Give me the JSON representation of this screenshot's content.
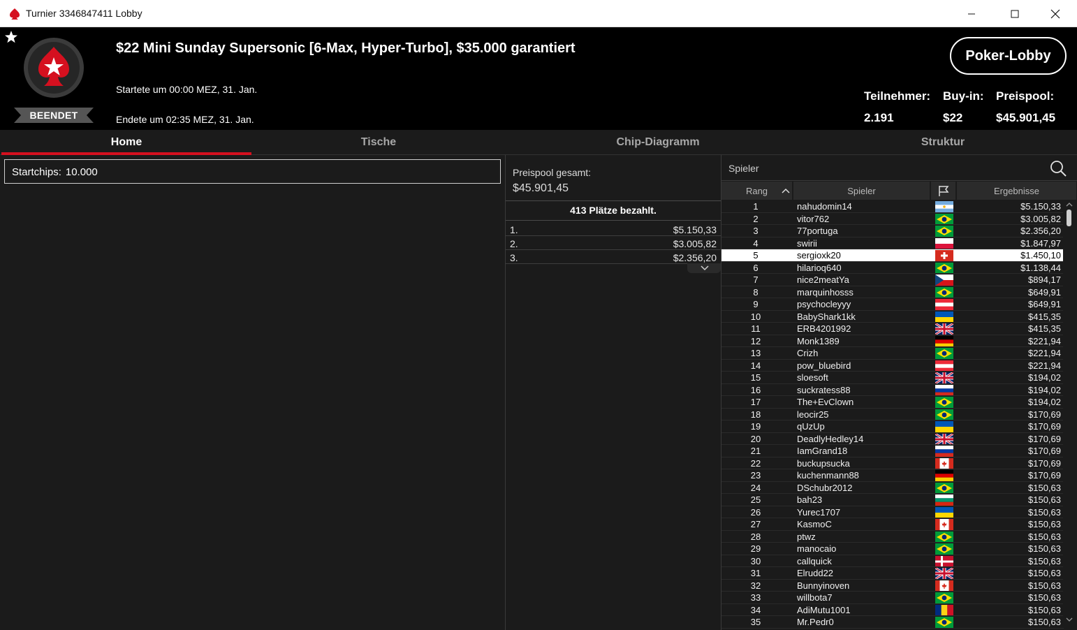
{
  "window": {
    "title": "Turnier 3346847411 Lobby"
  },
  "header": {
    "tournament_name": "$22 Mini Sunday Supersonic [6-Max, Hyper-Turbo], $35.000 garantiert",
    "start_text": "Startete um 00:00 MEZ, 31. Jan.",
    "end_text": "Endete um 02:35 MEZ, 31. Jan.",
    "status": "BEENDET",
    "lobby_button": "Poker-Lobby",
    "stats": {
      "participants_label": "Teilnehmer:",
      "participants": "2.191",
      "buyin_label": "Buy-in:",
      "buyin": "$22",
      "prizepool_label": "Preispool:",
      "prizepool": "$45.901,45"
    }
  },
  "tabs": [
    "Home",
    "Tische",
    "Chip-Diagramm",
    "Struktur"
  ],
  "home": {
    "startchips_label": "Startchips:",
    "startchips": "10.000"
  },
  "prizes": {
    "pool_label": "Preispool gesamt:",
    "pool_value": "$45.901,45",
    "paid_text": "413 Plätze bezahlt.",
    "rows": [
      {
        "place": "1.",
        "amount": "$5.150,33"
      },
      {
        "place": "2.",
        "amount": "$3.005,82"
      },
      {
        "place": "3.",
        "amount": "$2.356,20"
      }
    ]
  },
  "players": {
    "search_placeholder": "Spieler",
    "headers": {
      "rank": "Rang",
      "player": "Spieler",
      "result": "Ergebnisse"
    },
    "selected_rank": 5,
    "rows": [
      {
        "rank": "1",
        "name": "nahudomin14",
        "flag": "argentina",
        "result": "$5.150,33"
      },
      {
        "rank": "2",
        "name": "vitor762",
        "flag": "brazil",
        "result": "$3.005,82"
      },
      {
        "rank": "3",
        "name": "77portuga",
        "flag": "brazil",
        "result": "$2.356,20"
      },
      {
        "rank": "4",
        "name": "swirii",
        "flag": "poland",
        "result": "$1.847,97"
      },
      {
        "rank": "5",
        "name": "sergioxk20",
        "flag": "switzerland",
        "result": "$1.450,10"
      },
      {
        "rank": "6",
        "name": "hilarioq640",
        "flag": "brazil",
        "result": "$1.138,44"
      },
      {
        "rank": "7",
        "name": "nice2meatYa",
        "flag": "czech",
        "result": "$894,17"
      },
      {
        "rank": "8",
        "name": "marquinhosss",
        "flag": "brazil",
        "result": "$649,91"
      },
      {
        "rank": "9",
        "name": "psychocleyyy",
        "flag": "austria",
        "result": "$649,91"
      },
      {
        "rank": "10",
        "name": "BabyShark1kk",
        "flag": "ukraine",
        "result": "$415,35"
      },
      {
        "rank": "11",
        "name": "ERB4201992",
        "flag": "uk",
        "result": "$415,35"
      },
      {
        "rank": "12",
        "name": "Monk1389",
        "flag": "germany",
        "result": "$221,94"
      },
      {
        "rank": "13",
        "name": "Crizh",
        "flag": "brazil",
        "result": "$221,94"
      },
      {
        "rank": "14",
        "name": "pow_bluebird",
        "flag": "austria",
        "result": "$221,94"
      },
      {
        "rank": "15",
        "name": "sloesoft",
        "flag": "uk",
        "result": "$194,02"
      },
      {
        "rank": "16",
        "name": "suckratess88",
        "flag": "russia",
        "result": "$194,02"
      },
      {
        "rank": "17",
        "name": "The+EvClown",
        "flag": "brazil",
        "result": "$194,02"
      },
      {
        "rank": "18",
        "name": "leocir25",
        "flag": "brazil",
        "result": "$170,69"
      },
      {
        "rank": "19",
        "name": "qUzUp",
        "flag": "ukraine",
        "result": "$170,69"
      },
      {
        "rank": "20",
        "name": "DeadlyHedley14",
        "flag": "uk",
        "result": "$170,69"
      },
      {
        "rank": "21",
        "name": "IamGrand18",
        "flag": "russia",
        "result": "$170,69"
      },
      {
        "rank": "22",
        "name": "buckupsucka",
        "flag": "canada",
        "result": "$170,69"
      },
      {
        "rank": "23",
        "name": "kuchenmann88",
        "flag": "germany",
        "result": "$170,69"
      },
      {
        "rank": "24",
        "name": "DSchubr2012",
        "flag": "brazil",
        "result": "$150,63"
      },
      {
        "rank": "25",
        "name": "bah23",
        "flag": "bulgaria",
        "result": "$150,63"
      },
      {
        "rank": "26",
        "name": "Yurec1707",
        "flag": "ukraine",
        "result": "$150,63"
      },
      {
        "rank": "27",
        "name": "KasmoC",
        "flag": "canada",
        "result": "$150,63"
      },
      {
        "rank": "28",
        "name": "ptwz",
        "flag": "brazil",
        "result": "$150,63"
      },
      {
        "rank": "29",
        "name": "manocaio",
        "flag": "brazil",
        "result": "$150,63"
      },
      {
        "rank": "30",
        "name": "callquick",
        "flag": "denmark",
        "result": "$150,63"
      },
      {
        "rank": "31",
        "name": "Elrudd22",
        "flag": "uk",
        "result": "$150,63"
      },
      {
        "rank": "32",
        "name": "Bunnyinoven",
        "flag": "canada",
        "result": "$150,63"
      },
      {
        "rank": "33",
        "name": "willbota7",
        "flag": "brazil",
        "result": "$150,63"
      },
      {
        "rank": "34",
        "name": "AdiMutu1001",
        "flag": "romania",
        "result": "$150,63"
      },
      {
        "rank": "35",
        "name": "Mr.Pedr0",
        "flag": "brazil",
        "result": "$150,63"
      }
    ]
  },
  "colors": {
    "accent_red": "#d5101f",
    "background": "#1b1b1b",
    "header_bg": "#000000"
  }
}
